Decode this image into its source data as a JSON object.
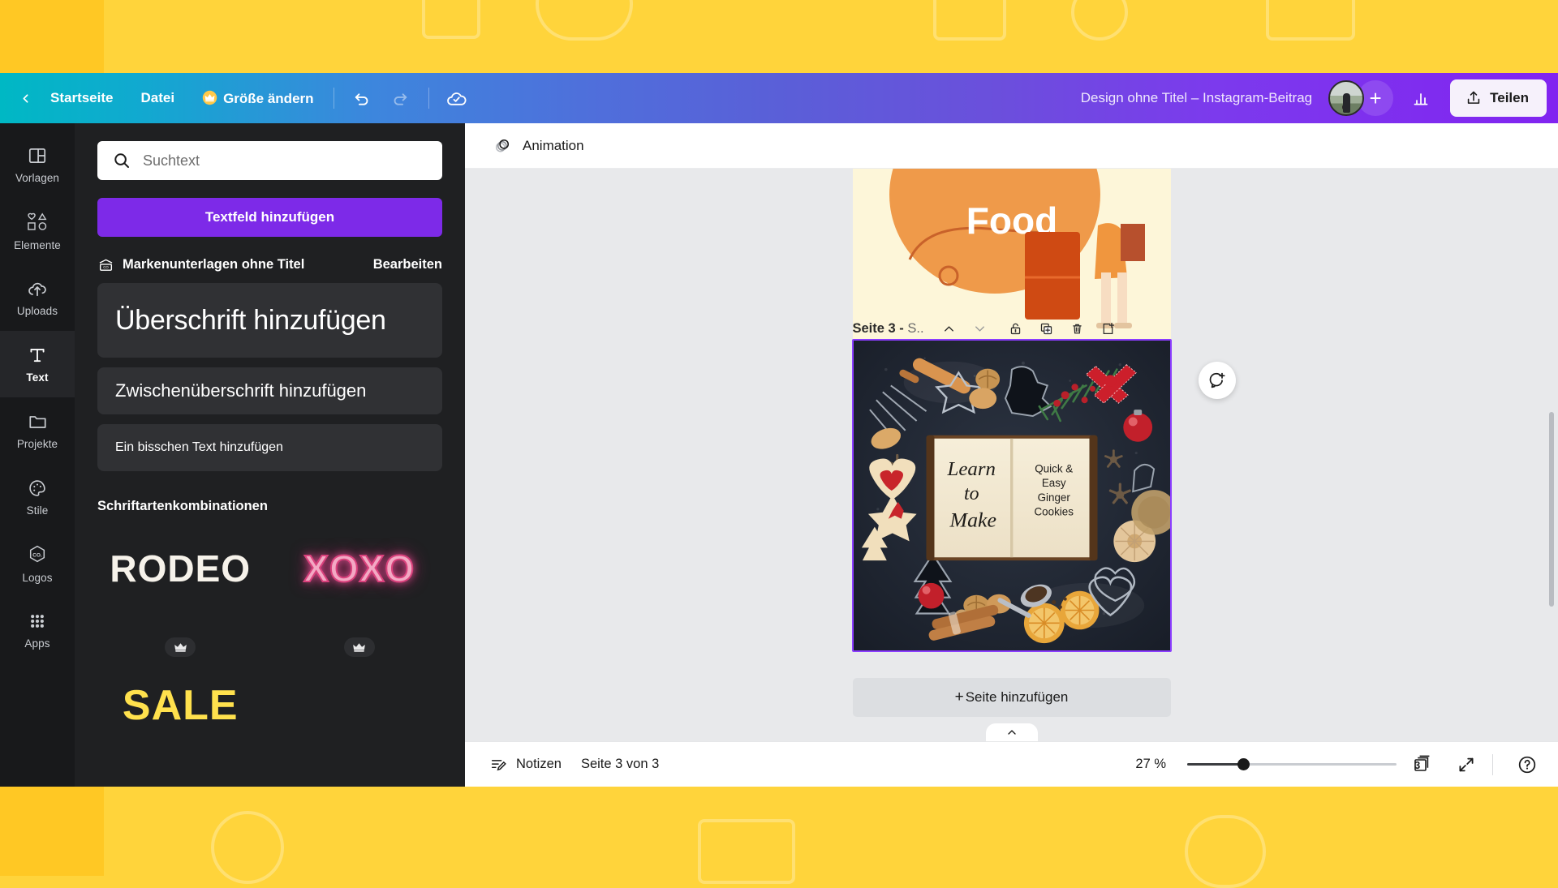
{
  "header": {
    "back_icon": "chevron-left-icon",
    "home_label": "Startseite",
    "file_label": "Datei",
    "resize_label": "Größe ändern",
    "resize_icon": "crown-icon",
    "undo_icon": "undo-icon",
    "redo_icon": "redo-icon",
    "cloud_icon": "cloud-saved-icon",
    "document_title": "Design ohne Titel – Instagram-Beitrag",
    "avatar_icon": "user-avatar",
    "add_collaborator_icon": "plus-icon",
    "stats_icon": "bar-chart-icon",
    "share_label": "Teilen",
    "share_icon": "upload-icon"
  },
  "rail": {
    "items": [
      {
        "label": "Vorlagen",
        "icon": "templates-icon",
        "active": false
      },
      {
        "label": "Elemente",
        "icon": "elements-icon",
        "active": false
      },
      {
        "label": "Uploads",
        "icon": "upload-cloud-icon",
        "active": false
      },
      {
        "label": "Text",
        "icon": "text-t-icon",
        "active": true
      },
      {
        "label": "Projekte",
        "icon": "folder-icon",
        "active": false
      },
      {
        "label": "Stile",
        "icon": "palette-icon",
        "active": false
      },
      {
        "label": "Logos",
        "icon": "logo-hex-icon",
        "active": false
      },
      {
        "label": "Apps",
        "icon": "apps-grid-icon",
        "active": false
      }
    ]
  },
  "panel": {
    "search": {
      "placeholder": "Suchtext",
      "value": "",
      "icon": "search-icon"
    },
    "add_textbox_label": "Textfeld hinzufügen",
    "brand": {
      "icon": "brand-kit-icon",
      "title": "Markenunterlagen ohne Titel",
      "edit_label": "Bearbeiten"
    },
    "text_styles": [
      {
        "label": "Überschrift hinzufügen",
        "size": "h1"
      },
      {
        "label": "Zwischenüberschrift hinzufügen",
        "size": "h2"
      },
      {
        "label": "Ein bisschen Text hinzufügen",
        "size": "h3"
      }
    ],
    "font_combos_title": "Schriftartenkombinationen",
    "font_combos": [
      {
        "word": "RODEO",
        "pro": true,
        "badge_icon": "crown-icon"
      },
      {
        "word": "XOXO",
        "pro": true,
        "badge_icon": "crown-icon"
      },
      {
        "word": "SALE",
        "pro": false,
        "badge_icon": "crown-icon"
      }
    ],
    "collapse_icon": "chevron-left-icon"
  },
  "canvas": {
    "toolbar": {
      "animation_label": "Animation",
      "animation_icon": "animation-circles-icon"
    },
    "page": {
      "title_main": "Seite 3 - ",
      "title_trunc": "S..",
      "move_up_icon": "chevron-up-icon",
      "move_down_icon": "chevron-down-icon",
      "lock_icon": "lock-icon",
      "duplicate_icon": "duplicate-page-icon",
      "delete_icon": "trash-icon",
      "insert_icon": "add-page-after-icon",
      "artwork": {
        "left_text": "Learn to Make",
        "right_text": "Quick & Easy Ginger Cookies",
        "right_lines": [
          "Quick &",
          "Easy",
          "Ginger",
          "Cookies"
        ],
        "left_lines": [
          "Learn",
          "to",
          "Make"
        ]
      }
    },
    "prev_page_text": "Food",
    "comment_icon": "add-comment-icon",
    "add_page_label": "Seite hinzufügen",
    "add_page_icon": "plus-icon",
    "scroll_up_icon": "chevron-up-icon"
  },
  "bottom": {
    "notes_label": "Notizen",
    "notes_icon": "notes-icon",
    "page_counter": "Seite 3 von 3",
    "zoom_label": "27 %",
    "zoom_value": 27,
    "pages_count": "3",
    "pages_icon": "grid-pages-icon",
    "fullscreen_icon": "expand-icon",
    "help_icon": "help-question-icon"
  },
  "colors": {
    "accent_purple": "#7d2ae8",
    "selection_purple": "#8b3dff",
    "panel_bg": "#1f2022",
    "rail_bg": "#18191b",
    "canvas_bg": "#e8e9eb",
    "backdrop_yellow": "#ffd43b"
  }
}
